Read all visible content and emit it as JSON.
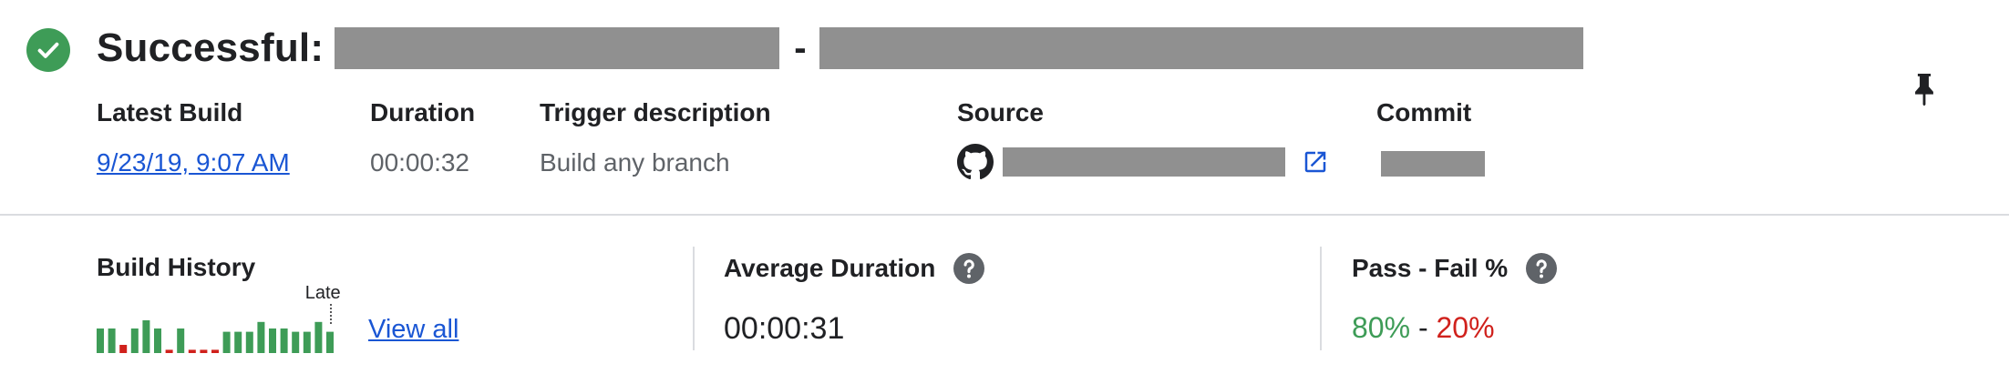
{
  "header": {
    "status_icon": "check-circle-icon",
    "status_color": "#3e9c57",
    "title": "Successful:",
    "title_separator": "-",
    "pin_icon": "pin-icon"
  },
  "details": {
    "latest_build": {
      "label": "Latest Build",
      "value": "9/23/19, 9:07 AM"
    },
    "duration": {
      "label": "Duration",
      "value": "00:00:32"
    },
    "trigger_description": {
      "label": "Trigger description",
      "value": "Build any branch"
    },
    "source": {
      "label": "Source",
      "icon": "github-icon",
      "link_icon": "open-in-new-icon"
    },
    "commit": {
      "label": "Commit"
    }
  },
  "build_history": {
    "title": "Build History",
    "latest_label": "Latest",
    "view_all": "View all",
    "pass_color": "#3e9c57",
    "fail_color": "#d0211c",
    "builds": [
      {
        "status": "pass",
        "level": 0.75
      },
      {
        "status": "pass",
        "level": 0.75
      },
      {
        "status": "fail",
        "level": 0.25
      },
      {
        "status": "pass",
        "level": 0.75
      },
      {
        "status": "pass",
        "level": 1.0
      },
      {
        "status": "pass",
        "level": 0.75
      },
      {
        "status": "fail",
        "level": 0.1
      },
      {
        "status": "pass",
        "level": 0.75
      },
      {
        "status": "fail",
        "level": 0.1
      },
      {
        "status": "fail",
        "level": 0.1
      },
      {
        "status": "fail",
        "level": 0.1
      },
      {
        "status": "pass",
        "level": 0.65
      },
      {
        "status": "pass",
        "level": 0.65
      },
      {
        "status": "pass",
        "level": 0.65
      },
      {
        "status": "pass",
        "level": 0.95
      },
      {
        "status": "pass",
        "level": 0.75
      },
      {
        "status": "pass",
        "level": 0.75
      },
      {
        "status": "pass",
        "level": 0.65
      },
      {
        "status": "pass",
        "level": 0.65
      },
      {
        "status": "pass",
        "level": 0.95
      },
      {
        "status": "pass",
        "level": 0.65
      }
    ]
  },
  "average_duration": {
    "title": "Average Duration",
    "help_icon": "help-icon",
    "value": "00:00:31"
  },
  "pass_fail": {
    "title": "Pass - Fail %",
    "help_icon": "help-icon",
    "pass": "80%",
    "separator": " - ",
    "fail": "20%"
  }
}
